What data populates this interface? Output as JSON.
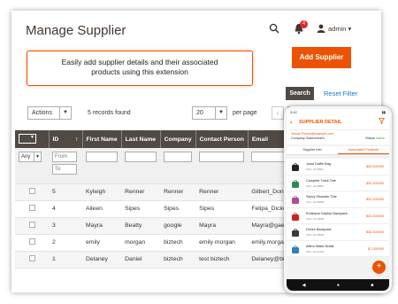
{
  "header": {
    "title": "Manage Supplier",
    "notification_count": "4",
    "user_name": "admin ▾"
  },
  "callout": {
    "line1": "Easily add supplier details and their associated",
    "line2": "products using this extension"
  },
  "toolbar": {
    "add_label": "Add Supplier",
    "search_label": "Search",
    "reset_label": "Reset Filter",
    "actions_label": "Actions",
    "records": "5 records found",
    "per_page_value": "20",
    "per_page_label": "per page"
  },
  "grid": {
    "columns": [
      "ID",
      "First Name",
      "Last Name",
      "Company",
      "Contact Person",
      "Email"
    ],
    "filter": {
      "any": "Any",
      "from": "From",
      "to": "To"
    },
    "rows": [
      {
        "id": "5",
        "first": "Kyleigh",
        "last": "Renner",
        "company": "Renner",
        "contact": "Renner",
        "email": "Gilbert_Donn"
      },
      {
        "id": "4",
        "first": "Aileen",
        "last": "Sipes",
        "company": "Sipes",
        "contact": "Sipes",
        "email": "Felipa_Dicker"
      },
      {
        "id": "3",
        "first": "Mayra",
        "last": "Beatty",
        "company": "google",
        "contact": "Mayra",
        "email": "Mayra@gaetz"
      },
      {
        "id": "2",
        "first": "emily",
        "last": "morgan",
        "company": "biztech",
        "contact": "emily morgan",
        "email": "emily.morgan"
      },
      {
        "id": "1",
        "first": "Delaney",
        "last": "Daniel",
        "company": "biztech",
        "contact": "test biztech",
        "email": "Delaney@biz"
      }
    ]
  },
  "phone": {
    "time": "3:42",
    "title": "SUPPLIER DETAIL",
    "email": "Jennie.Pouros@example.com",
    "company": "Company: Babershold's",
    "status_label": "Status:",
    "status_value": "Active",
    "tabs": [
      "Supplier Info",
      "Associated Products"
    ],
    "products": [
      {
        "name": "Joust Duffle Bag",
        "sku": "SKU: 24-MB01",
        "price": "$34.000000",
        "color": "#222222"
      },
      {
        "name": "Compete Track Tote",
        "sku": "SKU: 24-MB02",
        "price": "$32.000000",
        "color": "#2e8b57"
      },
      {
        "name": "Savvy Shoulder Tote",
        "sku": "SKU: 24-WB05",
        "price": "$32.000000",
        "color": "#b24d8f"
      },
      {
        "name": "Endeavor Daytrip Backpack",
        "sku": "SKU: 24-WB06",
        "price": "$33.000000",
        "color": "#cc2222"
      },
      {
        "name": "Driven Backpack",
        "sku": "SKU: 24-WB03",
        "price": "$36.000000",
        "color": "#3a3a3a"
      },
      {
        "name": "Affirm Water Bottle",
        "sku": "SKU: 24-UG06",
        "price": "$7.000000",
        "color": "#2f7fc1"
      }
    ]
  }
}
